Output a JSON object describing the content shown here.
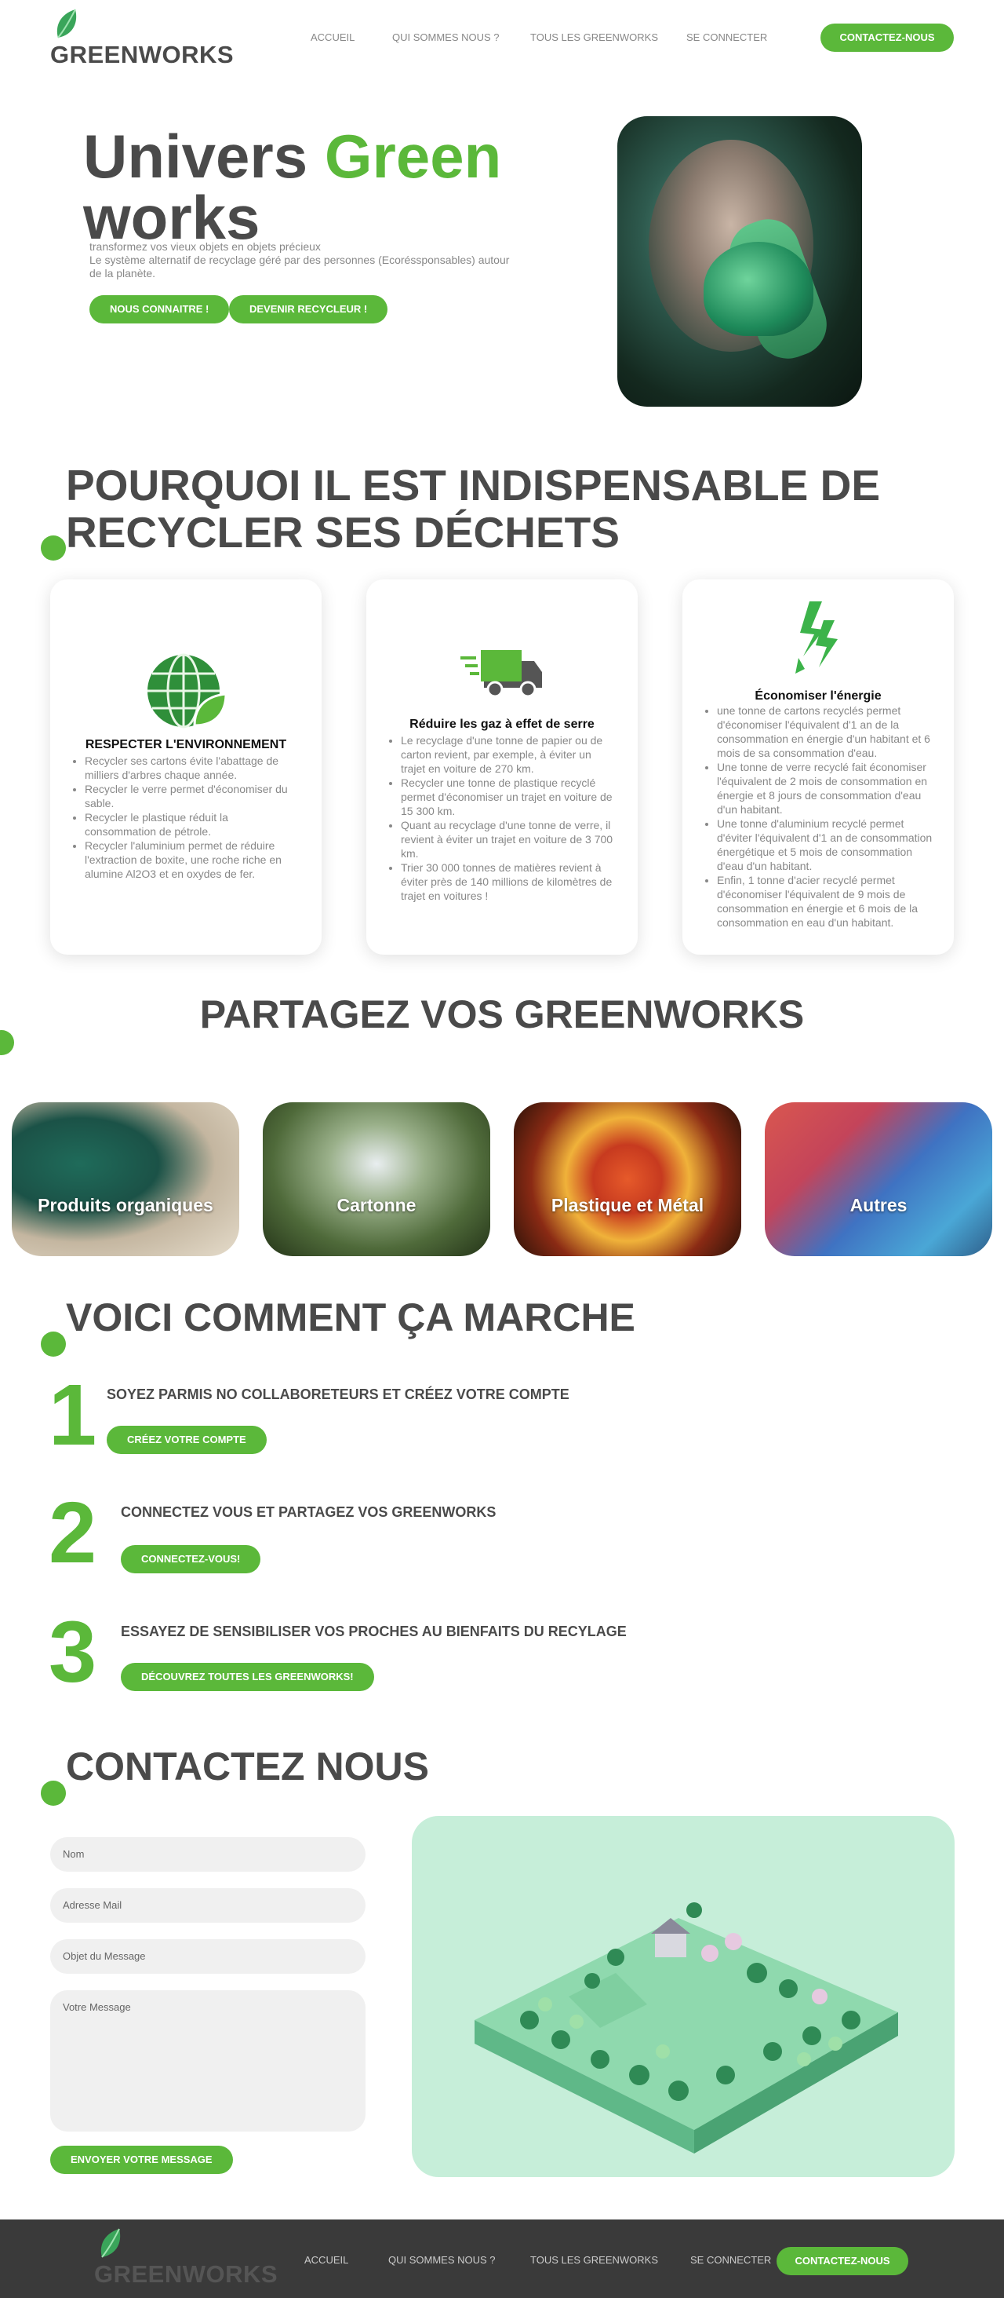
{
  "header": {
    "logo_text": "GREENWORKS",
    "nav": [
      "ACCUEIL",
      "QUI SOMMES NOUS ?",
      "TOUS LES GREENWORKS",
      "SE CONNECTER"
    ],
    "cta": "CONTACTEZ-NOUS"
  },
  "hero": {
    "title_part1": "Univers ",
    "title_part2": "Green",
    "title_part3": "works",
    "subtitle_line1": "transformez vos vieux objets en objets précieux",
    "subtitle_line2": "Le système alternatif de recyclage géré par des personnes (Ecoréssponsables) autour de la planète.",
    "btn_about": "NOUS CONNAITRE !",
    "btn_recycler": "DEVENIR RECYCLEUR !"
  },
  "why": {
    "heading_line1": "POURQUOI IL EST INDISPENSABLE DE",
    "heading_line2": "RECYCLER SES DÉCHETS",
    "cards": [
      {
        "icon": "globe-leaf-icon",
        "title": "RESPECTER L'ENVIRONNEMENT",
        "items": [
          "Recycler ses cartons évite l'abattage de milliers d'arbres chaque année.",
          "Recycler le verre permet d'économiser du sable.",
          "Recycler le plastique réduit la consommation de pétrole.",
          "Recycler l'aluminium permet de réduire l'extraction de boxite, une roche riche en alumine Al2O3 et en oxydes de fer."
        ]
      },
      {
        "icon": "delivery-truck-icon",
        "title": "Réduire les gaz à effet de serre",
        "items": [
          "Le recyclage d'une tonne de papier ou de carton revient, par exemple, à éviter un trajet en voiture de 270 km.",
          "Recycler une tonne de plastique recyclé permet d'économiser un trajet en voiture de 15 300 km.",
          "Quant au recyclage d'une tonne de verre, il revient à éviter un trajet en voiture de 3 700 km.",
          "Trier 30 000 tonnes de matières revient à éviter près de 140 millions de kilomètres de trajet en voitures !"
        ]
      },
      {
        "icon": "lightning-icon",
        "title": "Économiser l'énergie",
        "items": [
          "une tonne de cartons recyclés permet d'économiser l'équivalent d'1 an de la consommation en énergie d'un habitant et 6 mois de sa consommation d'eau.",
          "Une tonne de verre recyclé fait économiser l'équivalent de 2 mois de consommation en énergie et 8 jours de consommation d'eau d'un habitant.",
          "Une tonne d'aluminium recyclé permet d'éviter l'équivalent d'1 an de consommation énergétique et 5 mois de consommation d'eau d'un habitant.",
          "Enfin, 1 tonne d'acier recyclé permet d'économiser l'équivalent de 9 mois de consommation en énergie et 6 mois de la consommation en eau d'un habitant."
        ]
      }
    ]
  },
  "share": {
    "heading": "PARTAGEZ VOS GREENWORKS",
    "categories": [
      "Produits organiques",
      "Cartonne",
      "Plastique et Métal",
      "Autres"
    ]
  },
  "how": {
    "heading": "VOICI COMMENT ÇA MARCHE",
    "steps": [
      {
        "num": "1",
        "title": "SOYEZ PARMIS NO COLLABORETEURS ET CRÉEZ VOTRE COMPTE",
        "btn": "CRÉEZ VOTRE COMPTE"
      },
      {
        "num": "2",
        "title": "CONNECTEZ VOUS ET PARTAGEZ VOS GREENWORKS",
        "btn": "CONNECTEZ-VOUS!"
      },
      {
        "num": "3",
        "title": "ESSAYEZ DE SENSIBILISER VOS PROCHES AU BIENFAITS DU RECYLAGE",
        "btn": "DÉCOUVREZ TOUTES LES GREENWORKS!"
      }
    ]
  },
  "contact": {
    "heading": "CONTACTEZ NOUS",
    "fields": {
      "name": "Nom",
      "email": "Adresse Mail",
      "subject": "Objet du Message",
      "message": "Votre Message"
    },
    "send": "ENVOYER VOTRE MESSAGE"
  },
  "footer": {
    "logo_text": "GREENWORKS",
    "nav": [
      "ACCUEIL",
      "QUI SOMMES NOUS ?",
      "TOUS LES GREENWORKS",
      "SE CONNECTER"
    ],
    "cta": "CONTACTEZ-NOUS"
  },
  "colors": {
    "accent": "#5bb83a",
    "text": "#4a4a4a",
    "footer": "#3a3a3a"
  }
}
